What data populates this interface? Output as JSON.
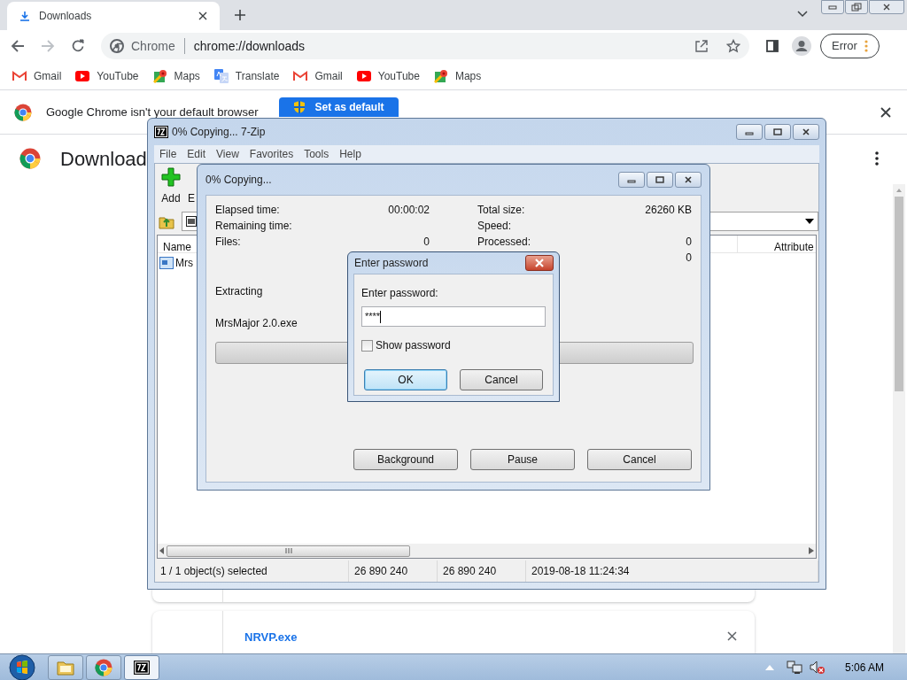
{
  "browser": {
    "tab": {
      "title": "Downloads"
    },
    "address": {
      "site": "Chrome",
      "url": "chrome://downloads"
    },
    "profile_button": "Error",
    "bookmarks": [
      {
        "label": "Gmail",
        "kind": "gmail"
      },
      {
        "label": "YouTube",
        "kind": "youtube"
      },
      {
        "label": "Maps",
        "kind": "maps"
      },
      {
        "label": "Translate",
        "kind": "translate"
      },
      {
        "label": "Gmail",
        "kind": "gmail"
      },
      {
        "label": "YouTube",
        "kind": "youtube"
      },
      {
        "label": "Maps",
        "kind": "maps"
      }
    ],
    "infobar": {
      "message": "Google Chrome isn't your default browser",
      "button": "Set as default"
    },
    "page": {
      "heading": "Download",
      "items": [
        {
          "name": "NRVP.exe"
        }
      ]
    }
  },
  "sevenzip": {
    "title": "0% Copying... 7-Zip",
    "menu": [
      "File",
      "Edit",
      "View",
      "Favorites",
      "Tools",
      "Help"
    ],
    "toolbar": [
      {
        "label": "Add",
        "kind": "add"
      },
      {
        "label": "E",
        "kind": "extract"
      }
    ],
    "columns": [
      "Name",
      "Attribute"
    ],
    "rows": [
      {
        "name": "Mrs"
      }
    ],
    "status_bar": [
      "1 / 1 object(s) selected",
      "26 890 240",
      "26 890 240",
      "2019-08-18 11:24:34"
    ]
  },
  "copy_dialog": {
    "title": "0% Copying...",
    "stats_left": [
      {
        "label": "Elapsed time:",
        "value": "00:00:02"
      },
      {
        "label": "Remaining time:"
      },
      {
        "label": "Files:",
        "value": "0"
      }
    ],
    "stats_right": [
      {
        "label": "Total size:",
        "value": "26260 KB"
      },
      {
        "label": "Speed:"
      },
      {
        "label": "Processed:",
        "value": "0"
      },
      {
        "value": "0"
      }
    ],
    "operation": "Extracting",
    "file": "MrsMajor 2.0.exe",
    "progress": {
      "level": 0
    },
    "buttons": [
      "Background",
      "Pause",
      "Cancel"
    ]
  },
  "password_dialog": {
    "title": "Enter password",
    "label": "Enter password:",
    "value": "****",
    "show_password": {
      "label": "Show password",
      "checked": false
    },
    "buttons": [
      {
        "label": "OK",
        "default": true
      },
      {
        "label": "Cancel",
        "default": false
      }
    ]
  },
  "taskbar": {
    "apps": [
      {
        "kind": "explorer",
        "selected": false
      },
      {
        "kind": "chrome",
        "selected": false
      },
      {
        "kind": "sevenzip",
        "selected": true
      }
    ],
    "clock": "5:06 AM"
  }
}
